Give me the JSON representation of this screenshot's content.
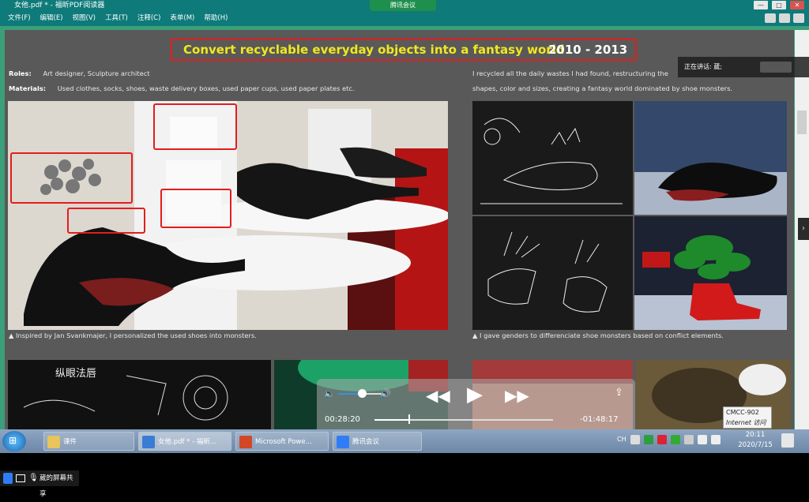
{
  "window": {
    "title": "女他.pdf * - 福昕PDF阅读器",
    "minimize": "—",
    "maximize": "□",
    "close": "✕"
  },
  "meeting": {
    "pill_label": "腾讯会议"
  },
  "menu": [
    {
      "label": "文件(F)"
    },
    {
      "label": "编辑(E)"
    },
    {
      "label": "视图(V)"
    },
    {
      "label": "工具(T)"
    },
    {
      "label": "注释(C)"
    },
    {
      "label": "表单(M)"
    },
    {
      "label": "帮助(H)"
    }
  ],
  "document": {
    "title": "Convert recyclable everyday objects into a fantasy world",
    "years": "2010 - 2013",
    "roles_label": "Roles:",
    "roles_value": "Art designer, Sculpture architect",
    "materials_label": "Materials:",
    "materials_value": "Used clothes, socks, shoes, waste delivery boxes, used paper cups, used paper plates etc.",
    "desc_line1": "I recycled all the daily wastes I had found, restructuring the",
    "desc_line2": "shapes, color and sizes, creating a fantasy world dominated by shoe monsters.",
    "caption_left": "▲ Inspired by Jan Svankmajer, I personalized the used shoes into monsters.",
    "caption_right": "▲ I gave genders to differenciate shoe monsters based on conflict elements.",
    "sketch_note": "纵眼法唇"
  },
  "speaker": {
    "label": "正在讲话: 葳;"
  },
  "player": {
    "elapsed": "00:28:20",
    "remaining": "-01:48:17",
    "progress": 0.19,
    "volume": 0.55
  },
  "tooltip": {
    "line1": "CMCC-902",
    "line2": "Internet 访问"
  },
  "taskbar": {
    "items": [
      {
        "label": "课件"
      },
      {
        "label": "女他.pdf * - 福昕..."
      },
      {
        "label": "Microsoft Powe..."
      },
      {
        "label": "腾讯会议"
      }
    ],
    "lang": "CH",
    "time": "20:11",
    "date": "2020/7/15"
  },
  "share": {
    "label": "葳的屏幕共享"
  },
  "colors": {
    "accent_red": "#e21d1d",
    "title_yellow": "#f3e71f",
    "page_gray": "#595959"
  }
}
